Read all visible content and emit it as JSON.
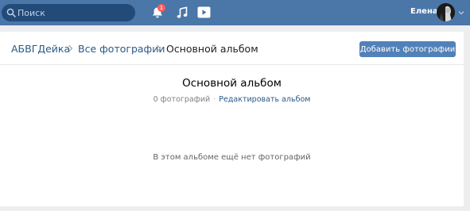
{
  "header": {
    "search_placeholder": "Поиск",
    "notifications_count": "1",
    "user_name": "Елена",
    "colors": {
      "bar": "#4a76a8",
      "search_bg": "#224b7a",
      "badge": "#ff5c5c"
    },
    "icons": [
      "search-icon",
      "bell-icon",
      "music-icon",
      "video-icon",
      "chevron-down-icon"
    ]
  },
  "breadcrumb": {
    "items": [
      "АБВГДейка",
      "Все фотографии",
      "Основной альбом"
    ]
  },
  "actions": {
    "add_photos_label": "Добавить фотографии"
  },
  "album": {
    "title": "Основной альбом",
    "photo_count": "0 фотографий",
    "separator": "·",
    "edit_label": "Редактировать альбом",
    "empty_message": "В этом альбоме ещё нет фотографий"
  },
  "colors": {
    "button": "#5181b8",
    "link": "#2a5885",
    "page_bg": "#edeef0"
  }
}
